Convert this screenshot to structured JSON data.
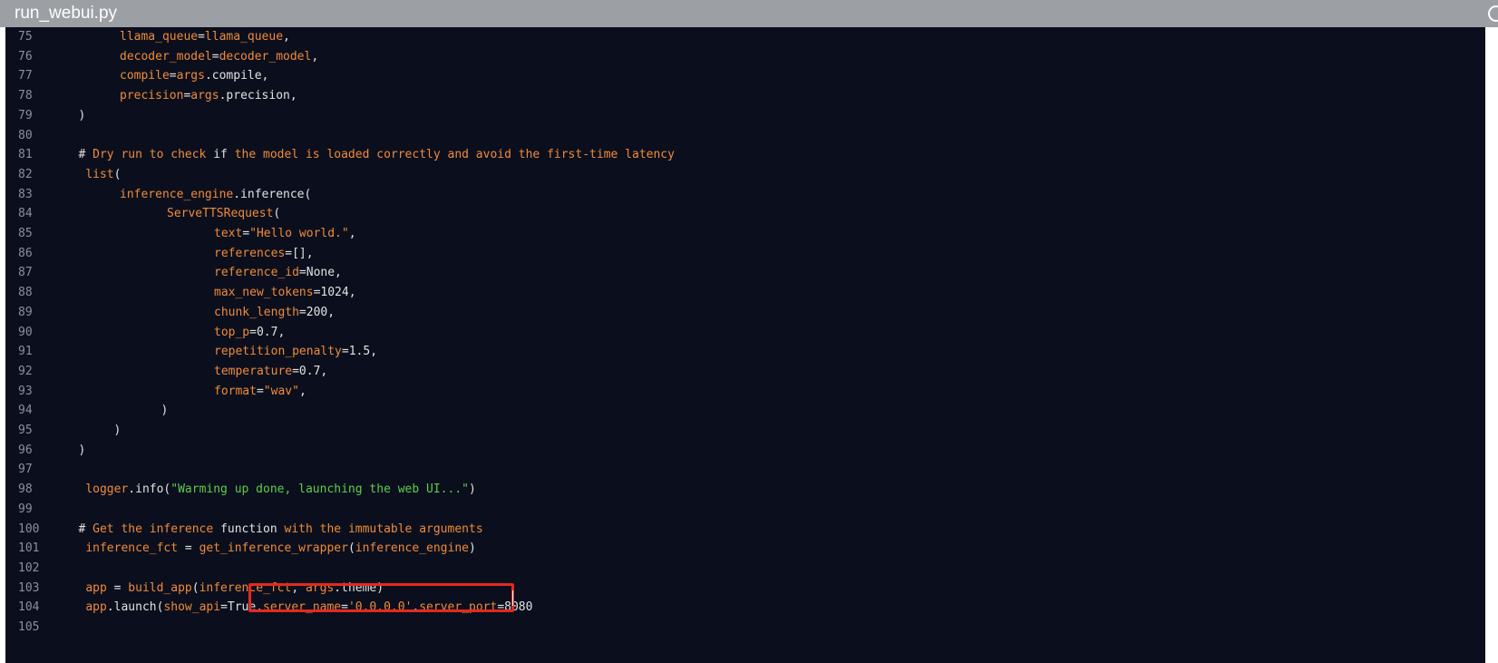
{
  "window": {
    "title": "run_webui.py"
  },
  "editor": {
    "lines": [
      {
        "number": "75",
        "indent": 8,
        "tokens": [
          [
            "o",
            "llama_queue"
          ],
          [
            "d",
            "="
          ],
          [
            "o",
            "llama_queue"
          ],
          [
            "d",
            ","
          ]
        ]
      },
      {
        "number": "76",
        "indent": 8,
        "tokens": [
          [
            "o",
            "decoder_model"
          ],
          [
            "d",
            "="
          ],
          [
            "o",
            "decoder_model"
          ],
          [
            "d",
            ","
          ]
        ]
      },
      {
        "number": "77",
        "indent": 8,
        "tokens": [
          [
            "o",
            "compile"
          ],
          [
            "d",
            "="
          ],
          [
            "o",
            "args"
          ],
          [
            "d",
            ".compile,"
          ]
        ]
      },
      {
        "number": "78",
        "indent": 8,
        "tokens": [
          [
            "o",
            "precision"
          ],
          [
            "d",
            "="
          ],
          [
            "o",
            "args"
          ],
          [
            "d",
            ".precision,"
          ]
        ]
      },
      {
        "number": "79",
        "indent": 1,
        "tokens": [
          [
            "d",
            ")"
          ]
        ]
      },
      {
        "number": "80",
        "indent": 0,
        "tokens": []
      },
      {
        "number": "81",
        "indent": 1,
        "tokens": [
          [
            "d",
            "# "
          ],
          [
            "o",
            "Dry run to check "
          ],
          [
            "d",
            "if "
          ],
          [
            "o",
            "the model is loaded correctly and avoid the first-time latency"
          ]
        ]
      },
      {
        "number": "82",
        "indent": 1,
        "tokens": [
          [
            "o",
            " list"
          ],
          [
            "d",
            "("
          ]
        ]
      },
      {
        "number": "83",
        "indent": 8,
        "tokens": [
          [
            "o",
            "inference_engine"
          ],
          [
            "d",
            ".inference("
          ]
        ]
      },
      {
        "number": "84",
        "indent": 16,
        "tokens": [
          [
            "o",
            "ServeTTSRequest"
          ],
          [
            "d",
            "("
          ]
        ]
      },
      {
        "number": "85",
        "indent": 24,
        "tokens": [
          [
            "o",
            "text"
          ],
          [
            "d",
            "="
          ],
          [
            "o",
            "\"Hello world.\""
          ],
          [
            "d",
            ","
          ]
        ]
      },
      {
        "number": "86",
        "indent": 24,
        "tokens": [
          [
            "o",
            "references"
          ],
          [
            "d",
            "=[],"
          ]
        ]
      },
      {
        "number": "87",
        "indent": 24,
        "tokens": [
          [
            "o",
            "reference_id"
          ],
          [
            "d",
            "=None,"
          ]
        ]
      },
      {
        "number": "88",
        "indent": 24,
        "tokens": [
          [
            "o",
            "max_new_tokens"
          ],
          [
            "d",
            "=1024,"
          ]
        ]
      },
      {
        "number": "89",
        "indent": 24,
        "tokens": [
          [
            "o",
            "chunk_length"
          ],
          [
            "d",
            "=200,"
          ]
        ]
      },
      {
        "number": "90",
        "indent": 24,
        "tokens": [
          [
            "o",
            "top_p"
          ],
          [
            "d",
            "=0.7,"
          ]
        ]
      },
      {
        "number": "91",
        "indent": 24,
        "tokens": [
          [
            "o",
            "repetition_penalty"
          ],
          [
            "d",
            "=1.5,"
          ]
        ]
      },
      {
        "number": "92",
        "indent": 24,
        "tokens": [
          [
            "o",
            "temperature"
          ],
          [
            "d",
            "=0.7,"
          ]
        ]
      },
      {
        "number": "93",
        "indent": 24,
        "tokens": [
          [
            "o",
            "format"
          ],
          [
            "d",
            "="
          ],
          [
            "o",
            "\"wav\""
          ],
          [
            "d",
            ","
          ]
        ]
      },
      {
        "number": "94",
        "indent": 15,
        "tokens": [
          [
            "d",
            ")"
          ]
        ]
      },
      {
        "number": "95",
        "indent": 7,
        "tokens": [
          [
            "d",
            ")"
          ]
        ]
      },
      {
        "number": "96",
        "indent": 1,
        "tokens": [
          [
            "d",
            ")"
          ]
        ]
      },
      {
        "number": "97",
        "indent": 0,
        "tokens": []
      },
      {
        "number": "98",
        "indent": 1,
        "tokens": [
          [
            "o",
            " logger"
          ],
          [
            "d",
            ".info("
          ],
          [
            "g",
            "\"Warming up done, launching the web UI...\""
          ],
          [
            "d",
            ")"
          ]
        ]
      },
      {
        "number": "99",
        "indent": 0,
        "tokens": []
      },
      {
        "number": "100",
        "indent": 1,
        "tokens": [
          [
            "d",
            "# "
          ],
          [
            "o",
            "Get the inference "
          ],
          [
            "d",
            "function "
          ],
          [
            "o",
            "with the immutable arguments"
          ]
        ]
      },
      {
        "number": "101",
        "indent": 1,
        "tokens": [
          [
            "o",
            " inference_fct"
          ],
          [
            "d",
            " = "
          ],
          [
            "o",
            "get_inference_wrapper"
          ],
          [
            "d",
            "("
          ],
          [
            "o",
            "inference_engine"
          ],
          [
            "d",
            ")"
          ]
        ]
      },
      {
        "number": "102",
        "indent": 0,
        "tokens": []
      },
      {
        "number": "103",
        "indent": 1,
        "tokens": [
          [
            "o",
            " app"
          ],
          [
            "d",
            " = "
          ],
          [
            "o",
            "build_app"
          ],
          [
            "d",
            "("
          ],
          [
            "o",
            "inference_fct"
          ],
          [
            "d",
            ", "
          ],
          [
            "o",
            "args"
          ],
          [
            "d",
            ".theme)"
          ]
        ]
      },
      {
        "number": "104",
        "indent": 1,
        "tokens": [
          [
            "o",
            " app"
          ],
          [
            "d",
            ".launch("
          ],
          [
            "o",
            "show_api"
          ],
          [
            "d",
            "=True,"
          ],
          [
            "o",
            "server_name"
          ],
          [
            "d",
            "="
          ],
          [
            "o",
            "'0.0.0.0'"
          ],
          [
            "d",
            ","
          ],
          [
            "o",
            "server_port"
          ],
          [
            "d",
            "=8080"
          ]
        ]
      },
      {
        "number": "105",
        "indent": 0,
        "tokens": []
      }
    ]
  }
}
